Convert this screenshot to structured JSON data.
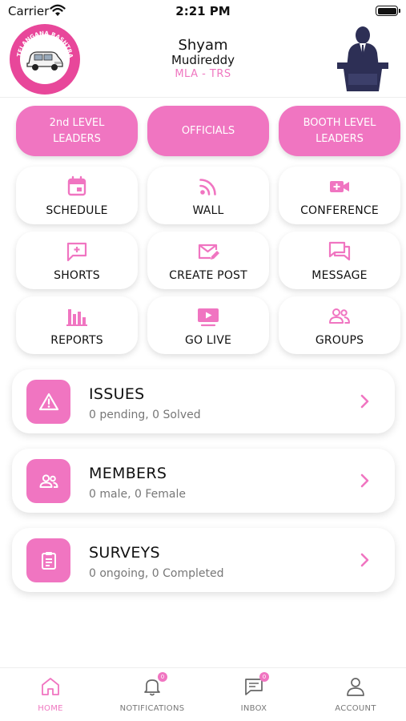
{
  "status_bar": {
    "carrier": "Carrier",
    "time": "2:21 PM"
  },
  "header": {
    "first_name": "Shyam",
    "last_name": "Mudireddy",
    "role": "MLA - TRS",
    "logo_text": "TELANGANA RASHTRA SAMITHI"
  },
  "top_buttons": [
    {
      "label_line1": "2nd LEVEL",
      "label_line2": "LEADERS"
    },
    {
      "label_line1": "OFFICIALS",
      "label_line2": ""
    },
    {
      "label_line1": "BOOTH LEVEL",
      "label_line2": "LEADERS"
    }
  ],
  "grid": [
    {
      "label": "SCHEDULE",
      "icon": "calendar-icon"
    },
    {
      "label": "WALL",
      "icon": "rss-icon"
    },
    {
      "label": "CONFERENCE",
      "icon": "video-add-icon"
    },
    {
      "label": "SHORTS",
      "icon": "chat-add-icon"
    },
    {
      "label": "CREATE POST",
      "icon": "mail-edit-icon"
    },
    {
      "label": "MESSAGE",
      "icon": "messages-icon"
    },
    {
      "label": "REPORTS",
      "icon": "bar-chart-icon"
    },
    {
      "label": "GO LIVE",
      "icon": "live-play-icon"
    },
    {
      "label": "GROUPS",
      "icon": "groups-icon"
    }
  ],
  "cards": [
    {
      "title": "ISSUES",
      "subtitle": "0 pending, 0 Solved",
      "icon": "warning-icon"
    },
    {
      "title": "MEMBERS",
      "subtitle": "0 male, 0 Female",
      "icon": "people-icon"
    },
    {
      "title": "SURVEYS",
      "subtitle": "0 ongoing, 0 Completed",
      "icon": "clipboard-icon"
    }
  ],
  "tabs": [
    {
      "label": "HOME",
      "icon": "home-icon",
      "active": true,
      "badge": ""
    },
    {
      "label": "NOTIFICATIONS",
      "icon": "bell-icon",
      "active": false,
      "badge": "0"
    },
    {
      "label": "INBOX",
      "icon": "chat-icon",
      "active": false,
      "badge": "0"
    },
    {
      "label": "ACCOUNT",
      "icon": "user-icon",
      "active": false,
      "badge": ""
    }
  ],
  "colors": {
    "accent": "#f075c1",
    "accent_text": "#ef77c0",
    "brand_pink": "#e8479a",
    "navy": "#2d2f55"
  }
}
